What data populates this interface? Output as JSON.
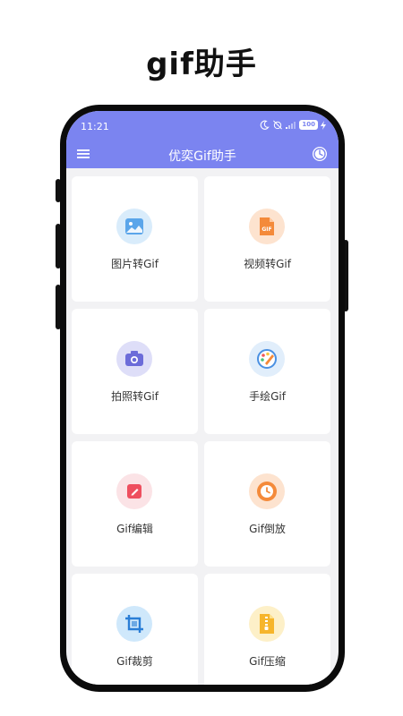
{
  "promo": {
    "title": "gif助手"
  },
  "status_bar": {
    "time": "11:21",
    "battery": "100"
  },
  "app_bar": {
    "title": "优奕Gif助手"
  },
  "cards": [
    {
      "label": "图片转Gif",
      "icon": "image-icon"
    },
    {
      "label": "视频转Gif",
      "icon": "gif-file-icon"
    },
    {
      "label": "拍照转Gif",
      "icon": "camera-icon"
    },
    {
      "label": "手绘Gif",
      "icon": "palette-icon"
    },
    {
      "label": "Gif编辑",
      "icon": "edit-icon"
    },
    {
      "label": "Gif倒放",
      "icon": "clock-icon"
    },
    {
      "label": "Gif裁剪",
      "icon": "crop-icon"
    },
    {
      "label": "Gif压缩",
      "icon": "zip-file-icon"
    }
  ],
  "colors": {
    "accent": "#7b84f0",
    "background": "#f2f2f4",
    "card": "#ffffff"
  }
}
